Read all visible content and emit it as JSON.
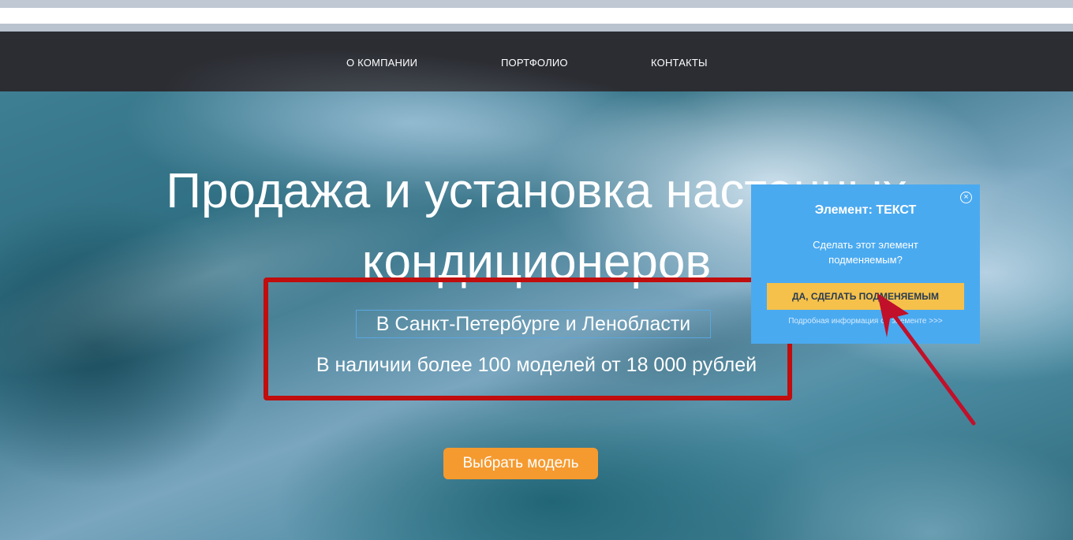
{
  "nav": {
    "items": [
      {
        "label": "О КОМПАНИИ"
      },
      {
        "label": "ПОРТФОЛИО"
      },
      {
        "label": "КОНТАКТЫ"
      }
    ]
  },
  "hero": {
    "headline_line1": "Продажа и установка настенных",
    "headline_line2": "кондиционеров",
    "subtitle_location": "В Санкт-Петербурге и Ленобласти",
    "subtitle_offer": "В наличии более 100 моделей от 18 000 рублей",
    "cta_label": "Выбрать модель"
  },
  "popup": {
    "close_glyph": "×",
    "title": "Элемент: ТЕКСТ",
    "question": "Сделать этот элемент подменяемым?",
    "confirm_label": "ДА, СДЕЛАТЬ ПОДМЕНЯЕМЫМ",
    "info_link": "Подробная информация об элементе >>>"
  },
  "colors": {
    "nav_background": "#2b2d33",
    "highlight_box": "#c00d0d",
    "cta": "#f59a2f",
    "popup": "#4aaaf0",
    "popup_button": "#f5c14a",
    "arrow": "#c0102a"
  }
}
